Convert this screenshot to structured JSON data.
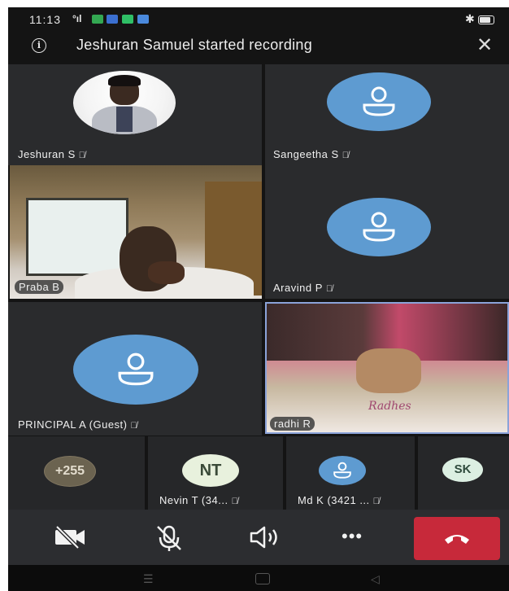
{
  "status_bar": {
    "time": "11:13",
    "signal": "°ıl",
    "bluetooth": "✱"
  },
  "banner": {
    "info_glyph": "i",
    "message": "Jeshuran Samuel started recording",
    "close_glyph": "✕"
  },
  "tiles": [
    {
      "name": "Jeshuran S",
      "muted": true,
      "kind": "photo"
    },
    {
      "name": "Sangeetha S",
      "muted": true,
      "kind": "avatar"
    },
    {
      "name": "Praba B",
      "muted": false,
      "kind": "video"
    },
    {
      "name": "Aravind P",
      "muted": true,
      "kind": "avatar"
    },
    {
      "name": "PRINCIPAL A (Guest)",
      "muted": true,
      "kind": "avatar"
    },
    {
      "name": "radhi R",
      "muted": false,
      "kind": "video",
      "overlay_text": "Radhes"
    }
  ],
  "strip": [
    {
      "label": "+255",
      "name": ""
    },
    {
      "label": "NT",
      "name": "Nevin T (34..."
    },
    {
      "label": "",
      "name": "Md K (3421 ..."
    },
    {
      "label": "SK",
      "name": ""
    }
  ],
  "controls": {
    "camera": "camera-off-icon",
    "mic": "mic-off-icon",
    "speaker": "speaker-icon",
    "more": "•••",
    "hangup": "hang-up-icon"
  },
  "colors": {
    "avatar_blue": "#5e9bd1",
    "hangup_red": "#c7293a",
    "background": "#141414"
  }
}
